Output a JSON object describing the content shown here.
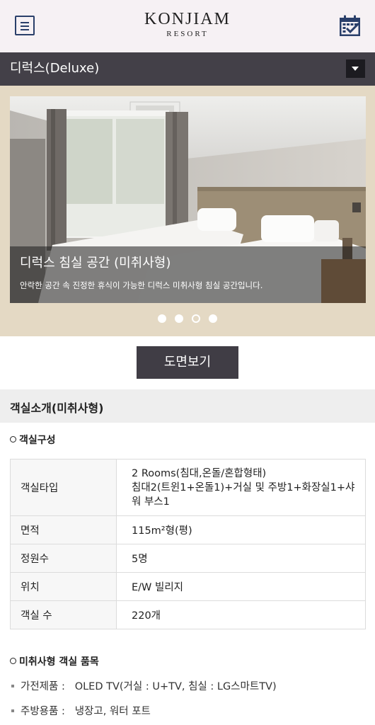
{
  "header": {
    "logo_main": "KONJIAM",
    "logo_sub": "RESORT",
    "menu_icon": "hamburger-menu-icon",
    "calendar_icon": "calendar-check-icon",
    "accent_color": "#2a3f6a"
  },
  "room_selector": {
    "selected": "디럭스(Deluxe)",
    "dropdown_icon": "chevron-down-icon"
  },
  "slider": {
    "caption_title": "디럭스 침실 공간 (미취사형)",
    "caption_desc": "안락한 공간 속 진정한 휴식이 가능한 디럭스 미취사형 침실 공간입니다.",
    "slide_count": 4,
    "active_index": 2
  },
  "floor_plan_button": "도면보기",
  "section": {
    "title": "객실소개(미취사형)"
  },
  "composition": {
    "title": "객실구성",
    "rows": [
      {
        "key": "객실타입",
        "value_lines": [
          "2 Rooms(침대,온돌/혼합형태)",
          "침대2(트윈1+온돌1)+거실 및 주방1+화장실1+샤",
          "워 부스1"
        ]
      },
      {
        "key": "면적",
        "value": "115m²형(평)"
      },
      {
        "key": "정원수",
        "value": "5명"
      },
      {
        "key": "위치",
        "value": "E/W 빌리지"
      },
      {
        "key": "객실 수",
        "value": "220개"
      }
    ]
  },
  "amenities": {
    "title": "미취사형 객실 품목",
    "items": [
      {
        "label": "가전제품 :",
        "value": "OLED TV(거실 : U+TV, 침실 : LG스마트TV)"
      },
      {
        "label": "주방용품 :",
        "value": "냉장고, 워터 포트"
      }
    ]
  }
}
